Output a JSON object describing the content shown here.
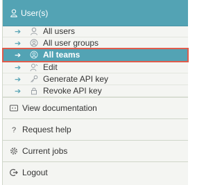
{
  "header": {
    "title": "User(s)",
    "icon": "user-icon"
  },
  "submenu": [
    {
      "label": "All users",
      "icon": "user-icon",
      "active": false
    },
    {
      "label": "All user groups",
      "icon": "group-icon",
      "active": false
    },
    {
      "label": "All teams",
      "icon": "team-icon",
      "active": true
    },
    {
      "label": "Edit",
      "icon": "user-edit-icon",
      "active": false
    },
    {
      "label": "Generate API key",
      "icon": "key-icon",
      "active": false
    },
    {
      "label": "Revoke API key",
      "icon": "lock-icon",
      "active": false
    }
  ],
  "menu": [
    {
      "label": "View documentation",
      "icon": "document-icon"
    },
    {
      "label": "Request help",
      "icon": "question-icon"
    },
    {
      "label": "Current jobs",
      "icon": "gear-icon"
    },
    {
      "label": "Logout",
      "icon": "logout-icon"
    }
  ],
  "colors": {
    "accent": "#53a3b4",
    "highlight_border": "#e05b4b",
    "panel_bg": "#f4f5f2"
  }
}
